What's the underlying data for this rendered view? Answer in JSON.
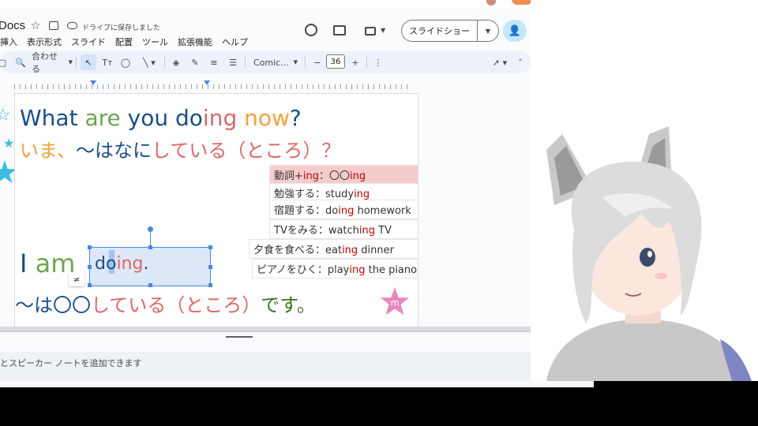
{
  "app": {
    "title": "Docs",
    "save_status": "ドライブに保存しました",
    "menu": [
      "挿入",
      "表示形式",
      "スライド",
      "配置",
      "ツール",
      "拡張機能",
      "ヘルプ"
    ],
    "slideshow_label": "スライドショー"
  },
  "toolbar": {
    "fit_label": "合わせる",
    "text_tool_label": "Tт",
    "font_name": "Comic...",
    "font_size": "36",
    "minus": "−",
    "plus": "+"
  },
  "slide": {
    "question": [
      {
        "text": "What ",
        "color": "blue"
      },
      {
        "text": "are ",
        "color": "green"
      },
      {
        "text": "you do",
        "color": "blue"
      },
      {
        "text": "ing ",
        "color": "red"
      },
      {
        "text": "now",
        "color": "orange"
      },
      {
        "text": "?",
        "color": "blue"
      }
    ],
    "question_jp": [
      {
        "text": "いま、",
        "color": "orange"
      },
      {
        "text": "〜はなに",
        "color": "blue"
      },
      {
        "text": "している（ところ）？",
        "color": "red"
      }
    ],
    "answer": [
      {
        "text": "I ",
        "color": "blue"
      },
      {
        "text": "am ",
        "color": "green"
      }
    ],
    "answer_box": [
      {
        "text": "do",
        "color": "blue"
      },
      {
        "text": "ing",
        "color": "red"
      },
      {
        "text": ".",
        "color": "blue"
      }
    ],
    "answer_jp": [
      {
        "text": "〜は〇〇",
        "color": "blue"
      },
      {
        "text": "している（ところ）",
        "color": "red"
      },
      {
        "text": "です。",
        "color": "dgreen"
      }
    ],
    "vocab": [
      {
        "pre": "動詞+",
        "ing": "ing",
        "post": "：〇〇",
        "ing2": "ing",
        "post2": ""
      },
      {
        "pre": "勉強する：study",
        "ing": "ing",
        "post": "",
        "ing2": "",
        "post2": ""
      },
      {
        "pre": "宿題する：do",
        "ing": "ing",
        "post": " homework",
        "ing2": "",
        "post2": ""
      },
      {
        "pre": "TVをみる：watch",
        "ing": "ing",
        "post": " TV",
        "ing2": "",
        "post2": ""
      },
      {
        "pre": "夕食を食べる：eat",
        "ing": "ing",
        "post": " dinner",
        "ing2": "",
        "post2": ""
      },
      {
        "pre": "ピアノをひく：play",
        "ing": "ing",
        "post": " the piano",
        "ing2": "",
        "post2": ""
      }
    ],
    "star_letter": "m"
  },
  "notes": {
    "placeholder_tail": "とスピーカー ノートを追加できます"
  },
  "colors": {
    "blue": "#1a4e8a",
    "green": "#6aa84f",
    "red": "#e06666",
    "orange": "#f6a23a",
    "dgreen": "#38761d",
    "accent": "#4a86e8"
  },
  "icons": [
    "star-icon",
    "move-to-folder-icon",
    "cloud-saved-icon",
    "history-icon",
    "comment-icon",
    "video-call-icon",
    "share-person-icon",
    "zoom-icon",
    "cursor-icon",
    "shape-icon",
    "line-icon",
    "fill-color-icon",
    "pen-icon",
    "align-icon",
    "more-icon",
    "pointer-icon",
    "collapse-icon"
  ]
}
